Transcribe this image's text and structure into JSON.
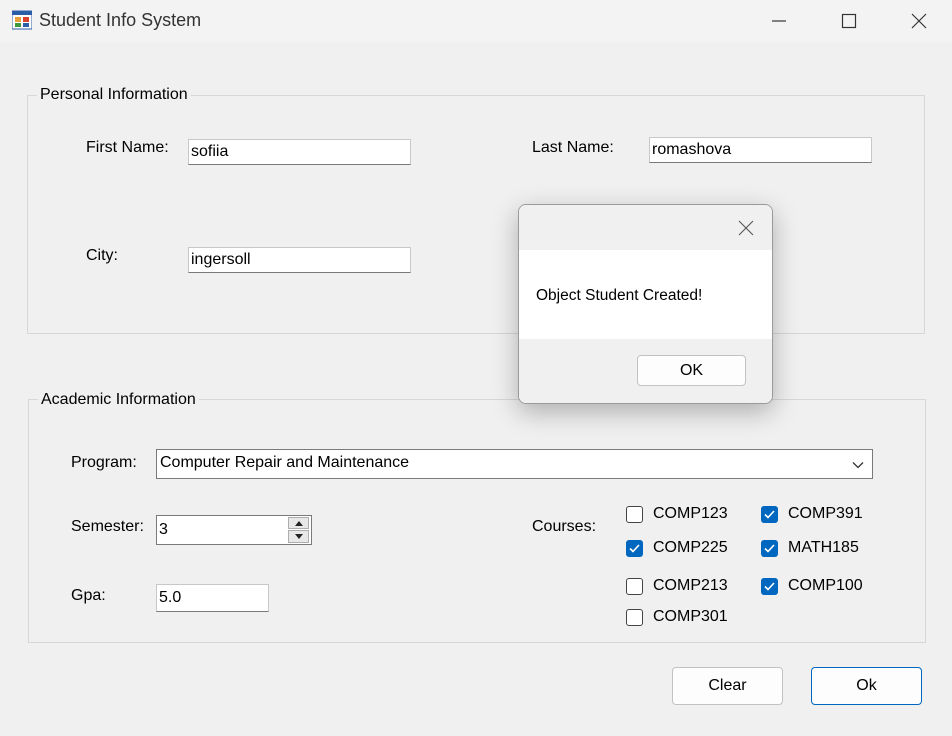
{
  "window": {
    "title": "Student Info System"
  },
  "personal": {
    "legend": "Personal Information",
    "first_name_label": "First Name:",
    "first_name_value": "sofiia",
    "last_name_label": "Last Name:",
    "last_name_value": "romashova",
    "city_label": "City:",
    "city_value": "ingersoll"
  },
  "academic": {
    "legend": "Academic Information",
    "program_label": "Program:",
    "program_value": "Computer Repair and Maintenance",
    "semester_label": "Semester:",
    "semester_value": "3",
    "gpa_label": "Gpa:",
    "gpa_value": "5.0",
    "courses_label": "Courses:",
    "courses": [
      {
        "label": "COMP123",
        "checked": false
      },
      {
        "label": "COMP391",
        "checked": true
      },
      {
        "label": "COMP225",
        "checked": true
      },
      {
        "label": "MATH185",
        "checked": true
      },
      {
        "label": "COMP213",
        "checked": false
      },
      {
        "label": "COMP100",
        "checked": true
      },
      {
        "label": "COMP301",
        "checked": false
      }
    ]
  },
  "buttons": {
    "clear": "Clear",
    "ok": "Ok"
  },
  "dialog": {
    "message": "Object Student Created!",
    "ok": "OK"
  },
  "icons": {
    "app": "app-icon",
    "minimize": "minimize-icon",
    "maximize": "maximize-icon",
    "close": "close-icon",
    "dropdown": "chevron-down-icon",
    "spin_up": "spin-up-icon",
    "spin_down": "spin-down-icon",
    "check": "checkmark-icon"
  },
  "colors": {
    "accent": "#0067c0",
    "window_bg": "#f0f0f0"
  }
}
